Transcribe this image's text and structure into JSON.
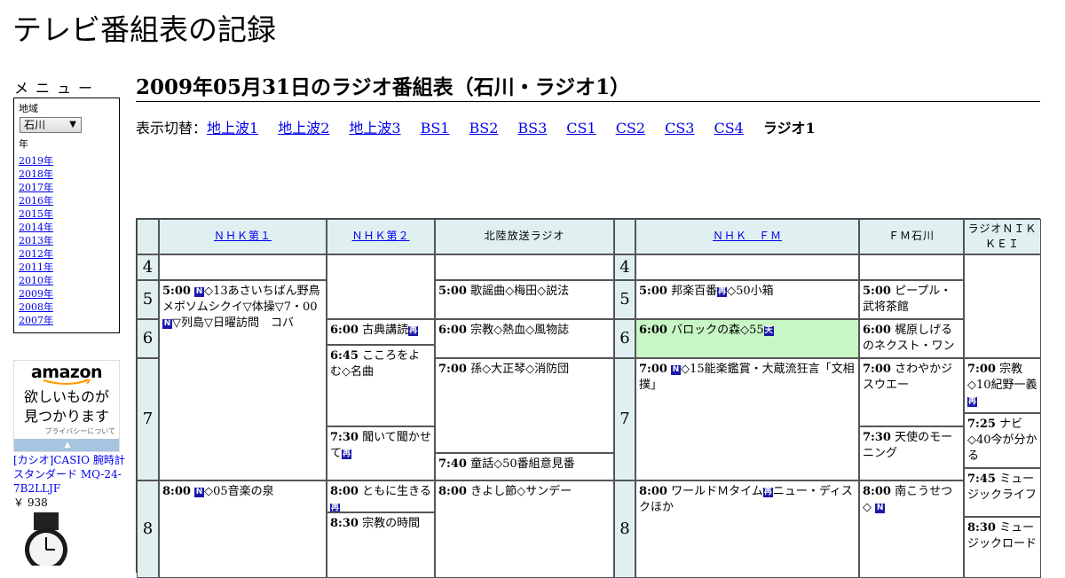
{
  "site": {
    "title": "テレビ番組表の記録"
  },
  "menu": {
    "title": "メニュー",
    "region_label": "地域",
    "region_value": "石川",
    "year_label": "年",
    "years": [
      "2019年",
      "2018年",
      "2017年",
      "2016年",
      "2015年",
      "2014年",
      "2013年",
      "2012年",
      "2011年",
      "2010年",
      "2009年",
      "2008年",
      "2007年"
    ]
  },
  "ad": {
    "logo": "amazon",
    "copy_line1": "欲しいものが",
    "copy_line2": "見つかります",
    "privacy": "プライバシーについて",
    "product_title": "[カシオ]CASIO 腕時計 スタンダード MQ-24-7B2LLJF",
    "price": "￥ 938"
  },
  "page": {
    "heading": "2009年05月31日のラジオ番組表（石川・ラジオ1）"
  },
  "switcher": {
    "label": "表示切替：",
    "links": [
      "地上波1",
      "地上波2",
      "地上波3",
      "BS1",
      "BS2",
      "BS3",
      "CS1",
      "CS2",
      "CS3",
      "CS4"
    ],
    "current": "ラジオ1"
  },
  "channels": [
    "ＮＨＫ第１",
    "ＮＨＫ第２",
    "北陸放送ラジオ",
    "ＮＨＫ　ＦＭ",
    "ＦＭ石川",
    "ラジオＮＩＫＫＥＩ"
  ],
  "hours": [
    "4",
    "5",
    "6",
    "7",
    "8"
  ],
  "icons": {
    "new": "N",
    "rerun": "再",
    "stereo": "天"
  },
  "programs": {
    "nhk1_0500": {
      "time": "5:00",
      "text": "◇13あさいちばん野鳥メボソムシクイ▽体操▽7・00",
      "text2": "▽列島▽日曜訪問　コバ"
    },
    "nhk1_0800": {
      "time": "8:00",
      "text": "◇05音楽の泉"
    },
    "nhk2_0600": {
      "time": "6:00",
      "text": "古典講読"
    },
    "nhk2_0645": {
      "time": "6:45",
      "text": "こころをよむ◇名曲"
    },
    "nhk2_0730": {
      "time": "7:30",
      "text": "聞いて聞かせて"
    },
    "nhk2_0800": {
      "time": "8:00",
      "text": "ともに生きる"
    },
    "nhk2_0830": {
      "time": "8:30",
      "text": "宗教の時間"
    },
    "mro_0500": {
      "time": "5:00",
      "text": "歌謡曲◇梅田◇説法"
    },
    "mro_0600": {
      "time": "6:00",
      "text": "宗教◇熱血◇風物誌"
    },
    "mro_0700": {
      "time": "7:00",
      "text": "孫◇大正琴◇消防団"
    },
    "mro_0740": {
      "time": "7:40",
      "text": "童話◇50番組意見番"
    },
    "mro_0800": {
      "time": "8:00",
      "text": "きよし節◇サンデー"
    },
    "fm_0500": {
      "time": "5:00",
      "text": "邦楽百番",
      "text2": "◇50小箱"
    },
    "fm_0600": {
      "time": "6:00",
      "text": "バロックの森◇55"
    },
    "fm_0700": {
      "time": "7:00",
      "text": "◇15能楽鑑賞・大蔵流狂言「文相撲」"
    },
    "fm_0800": {
      "time": "8:00",
      "text": "ワールドＭタイム",
      "text2": "ニュー・ディスクほか"
    },
    "fmi_0500": {
      "time": "5:00",
      "text": "ピープル・武将茶館"
    },
    "fmi_0600": {
      "time": "6:00",
      "text": "梶原しげるのネクスト・ワン"
    },
    "fmi_0700": {
      "time": "7:00",
      "text": "さわやかジスウエー"
    },
    "fmi_0730": {
      "time": "7:30",
      "text": "天使のモーニング"
    },
    "fmi_0800": {
      "time": "8:00",
      "text": "南こうせつ◇"
    },
    "nik_0700": {
      "time": "7:00",
      "text": "宗教◇10紀野一義"
    },
    "nik_0725": {
      "time": "7:25",
      "text": "ナビ◇40今が分かる"
    },
    "nik_0745": {
      "time": "7:45",
      "text": "ミュージックライフ"
    },
    "nik_0830": {
      "time": "8:30",
      "text": "ミュージックロード"
    }
  },
  "colors": {
    "header_bg": "#e0f0f0",
    "highlight_bg": "#c8f7c5",
    "link": "#0000ee"
  }
}
